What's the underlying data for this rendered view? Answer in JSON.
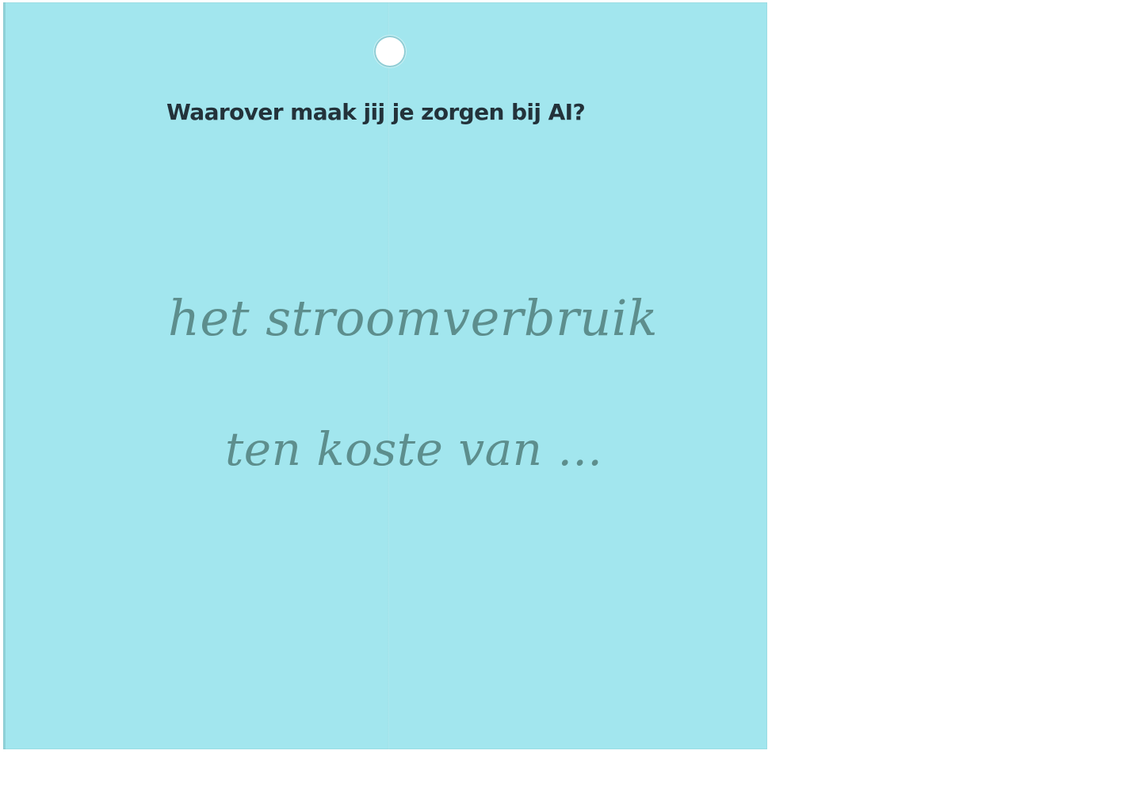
{
  "card": {
    "question": "Waarover maak jij je zorgen bij AI?",
    "answer_lines": [
      "het stroomverbruik",
      "ten koste van ..."
    ],
    "colors": {
      "card_background": "#a2e6ee",
      "question_text": "#23323a",
      "handwriting_ink": "#5d8e8d"
    }
  }
}
